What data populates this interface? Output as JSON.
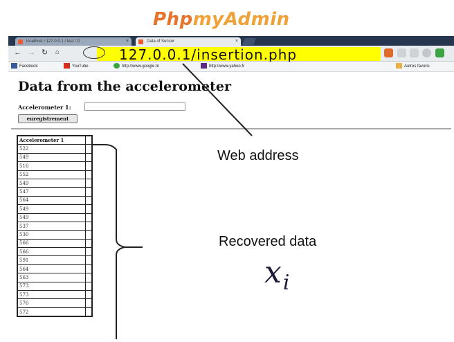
{
  "banner": {
    "part1": "Php",
    "part2": "myAdmin"
  },
  "browser": {
    "tabs": [
      {
        "label": "localhost / 127.0.0.1 / test / D"
      },
      {
        "label": "Data of Sensor"
      }
    ],
    "address": "127.0.0.1/insertion.php",
    "bookmarks": [
      "Facebook",
      "YouTube",
      "http://www.google.tn",
      "http://www.yahoo.fr",
      "Autres favoris"
    ]
  },
  "page": {
    "title": "Data from the accelerometer",
    "field_label": "Accelerometer 1:",
    "submit_label": "enregistrement",
    "table_header": "Accelerometer 1",
    "table_values": [
      "522",
      "549",
      "516",
      "552",
      "549",
      "547",
      "564",
      "549",
      "549",
      "537",
      "530",
      "566",
      "566",
      "591",
      "564",
      "563",
      "573",
      "573",
      "576",
      "572"
    ]
  },
  "annotations": {
    "web_address": "Web address",
    "recovered_data": "Recovered data",
    "xi_base": "x",
    "xi_sub": "i"
  }
}
